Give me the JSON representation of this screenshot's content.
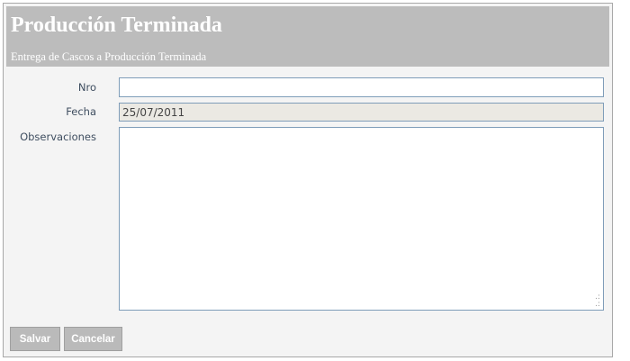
{
  "header": {
    "title": "Producción Terminada",
    "subtitle": "Entrega de Cascos a Producción Terminada"
  },
  "form": {
    "nro": {
      "label": "Nro",
      "value": ""
    },
    "fecha": {
      "label": "Fecha",
      "value": "25/07/2011"
    },
    "observaciones": {
      "label": "Observaciones",
      "value": ""
    }
  },
  "buttons": {
    "save": "Salvar",
    "cancel": "Cancelar"
  }
}
